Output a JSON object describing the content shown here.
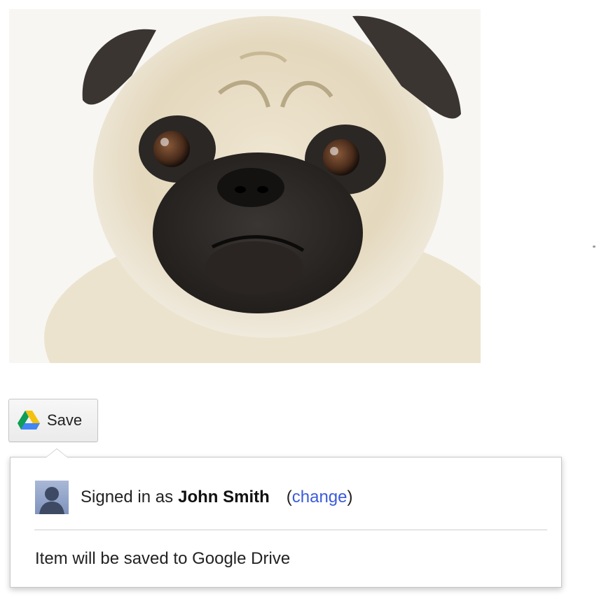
{
  "save_button": {
    "label": "Save",
    "icon": "google-drive-icon"
  },
  "photo": {
    "subject": "pug-face-photo"
  },
  "popup": {
    "signed_in_prefix": "Signed in as",
    "user_name": "John Smith",
    "change_open": "(",
    "change_label": "change",
    "change_close": ")",
    "save_destination": "Item will be saved to Google Drive",
    "avatar_icon": "default-user-avatar-icon"
  },
  "colors": {
    "link": "#3b5bdb",
    "drive_green": "#0f9d58",
    "drive_yellow": "#f4c20d",
    "drive_blue": "#4285f4"
  }
}
